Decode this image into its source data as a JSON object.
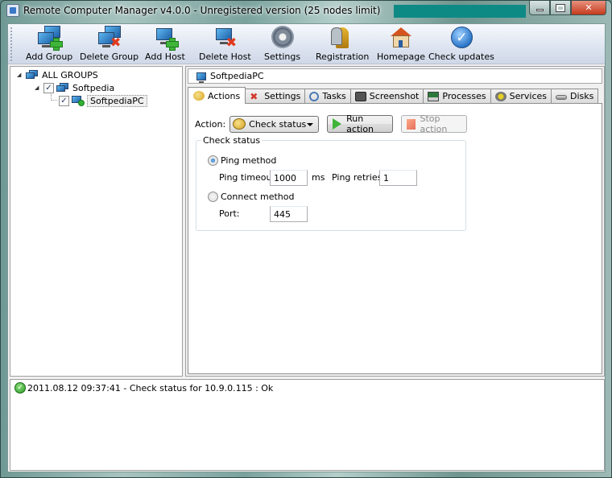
{
  "window": {
    "title": "Remote Computer Manager v4.0.0 - Unregistered version (25 nodes limit)",
    "controls": {
      "minimize": "minimize",
      "maximize": "maximize",
      "close": "✕"
    }
  },
  "toolbar": {
    "items": [
      {
        "label": "Add Group",
        "icon": "add-group-icon"
      },
      {
        "label": "Delete Group",
        "icon": "delete-group-icon"
      },
      {
        "label": "Add Host",
        "icon": "add-host-icon"
      },
      {
        "label": "Delete Host",
        "icon": "delete-host-icon"
      },
      {
        "label": "Settings",
        "icon": "gear-icon"
      },
      {
        "label": "Registration",
        "icon": "keys-icon"
      },
      {
        "label": "Homepage",
        "icon": "house-icon"
      },
      {
        "label": "Check updates",
        "icon": "check-icon"
      }
    ]
  },
  "tree": {
    "root": {
      "label": "ALL GROUPS",
      "expanded": true
    },
    "group": {
      "label": "Softpedia",
      "checked": true,
      "expanded": true
    },
    "host": {
      "label": "SoftpediaPC",
      "checked": true,
      "status": "online",
      "selected": true
    },
    "checkmark": "✓",
    "expander": "◢"
  },
  "host_header": {
    "label": "SoftpediaPC"
  },
  "tabs": [
    {
      "label": "Actions",
      "active": true
    },
    {
      "label": "Settings",
      "active": false
    },
    {
      "label": "Tasks",
      "active": false
    },
    {
      "label": "Screenshot",
      "active": false
    },
    {
      "label": "Processes",
      "active": false
    },
    {
      "label": "Services",
      "active": false
    },
    {
      "label": "Disks",
      "active": false
    }
  ],
  "actions": {
    "action_label": "Action:",
    "action_value": "Check status",
    "run_label": "Run action",
    "stop_label": "Stop action",
    "stop_enabled": false,
    "group_title": "Check status",
    "ping_method_label": "Ping method",
    "ping_method_selected": true,
    "ping_timeout_label": "Ping timeout:",
    "ping_timeout_value": "1000",
    "ms_label": "ms",
    "ping_retries_label": "Ping retries:",
    "ping_retries_value": "1",
    "connect_method_label": "Connect method",
    "connect_method_selected": false,
    "port_label": "Port:",
    "port_value": "445"
  },
  "log": {
    "entries": [
      {
        "status": "ok",
        "text": "2011.08.12 09:37:41 - Check status for  10.9.0.115 : Ok",
        "icon_glyph": "✓"
      }
    ]
  },
  "colors": {
    "title_highlight": "#0e8a85",
    "toolbar_bg": "#dde4f0",
    "ok_green": "#2e9a2a"
  }
}
